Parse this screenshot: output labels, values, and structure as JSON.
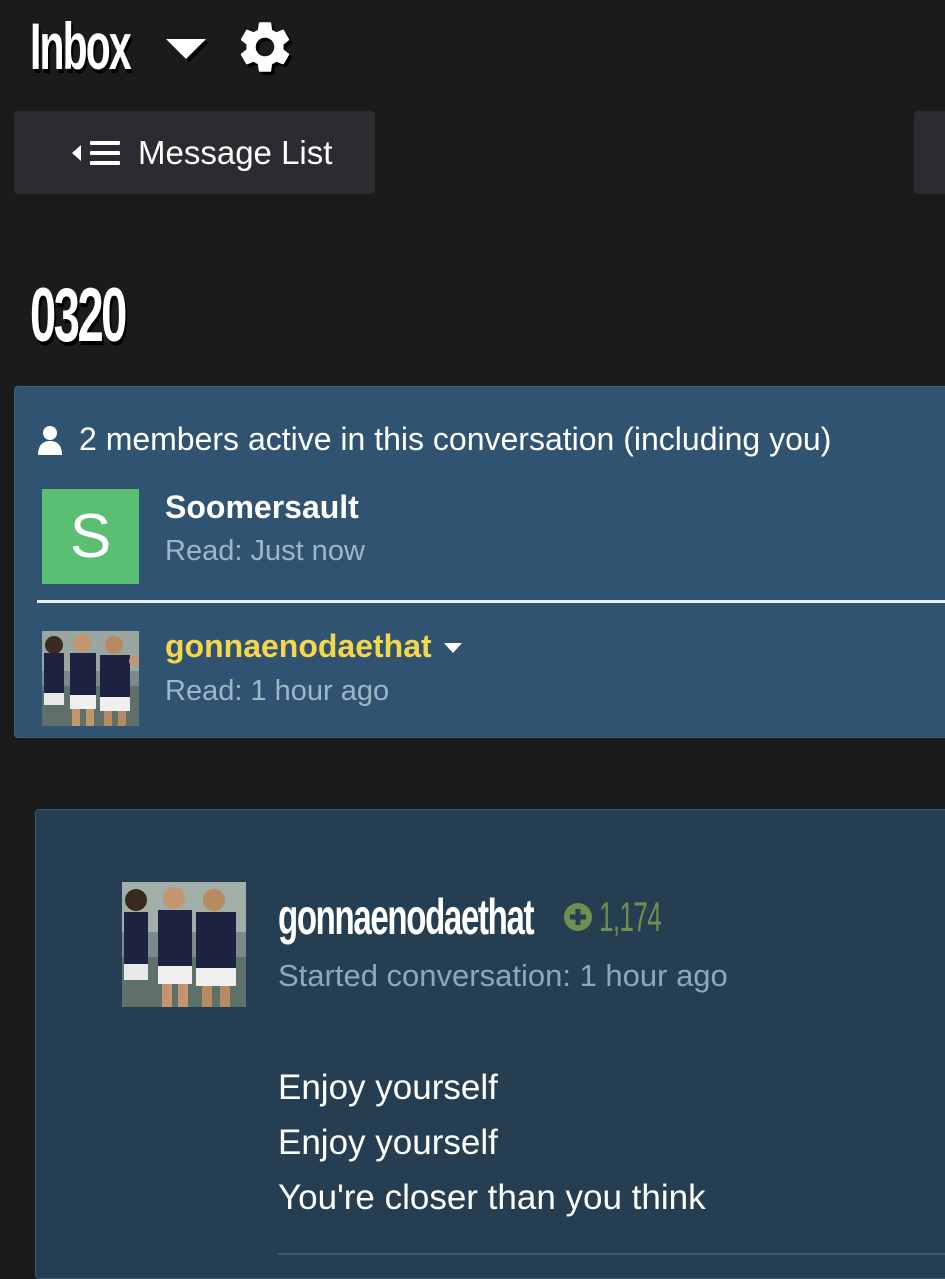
{
  "header": {
    "title": "Inbox"
  },
  "toolbar": {
    "message_list_label": "Message List"
  },
  "conversation": {
    "title": "0320"
  },
  "members": {
    "header_text": "2 members active in this conversation (including you)",
    "items": [
      {
        "avatar_letter": "S",
        "name": "Soomersault",
        "read_status": "Read: Just now",
        "avatar_color": "#5bbf73"
      },
      {
        "name": "gonnaenodaethat",
        "read_status": "Read: 1 hour ago",
        "name_color": "#f6d64a"
      }
    ]
  },
  "message": {
    "author": "gonnaenodaethat",
    "reputation": "1,174",
    "started": "Started conversation: 1 hour ago",
    "lines": [
      "Enjoy yourself",
      "Enjoy yourself",
      "You're closer than you think"
    ]
  },
  "colors": {
    "background": "#1b1b1c",
    "members_panel": "#2f5370",
    "message_panel": "#263e52",
    "accent_yellow": "#f6d64a",
    "reputation_green": "#6f8f4f"
  }
}
